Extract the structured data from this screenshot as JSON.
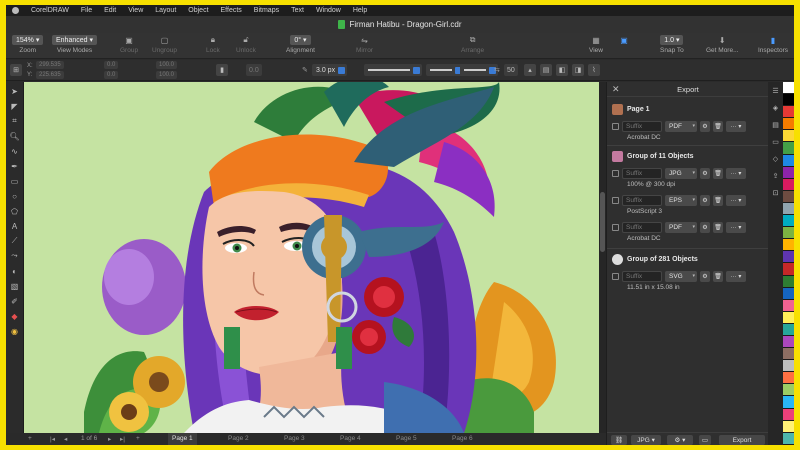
{
  "menubar": {
    "items": [
      "CorelDRAW",
      "File",
      "Edit",
      "View",
      "Layout",
      "Object",
      "Effects",
      "Bitmaps",
      "Text",
      "Window",
      "Help"
    ]
  },
  "window": {
    "title": "Firman Hatibu - Dragon-Girl.cdr"
  },
  "toolbar": {
    "zoom": {
      "value": "154%",
      "label": "Zoom"
    },
    "view_modes": {
      "value": "Enhanced",
      "label": "View Modes"
    },
    "group_label": "Group",
    "ungroup_label": "Ungroup",
    "lock_label": "Lock",
    "unlock_label": "Unlock",
    "alignment": {
      "value": "0°",
      "label": "Alignment"
    },
    "mirror_label": "Mirror",
    "arrange_label": "Arrange",
    "view_label": "View",
    "snap": {
      "value": "1.0",
      "label": "Snap To"
    },
    "get_more_label": "Get More...",
    "inspectors_label": "Inspectors"
  },
  "propbar": {
    "x": "299.535",
    "y": "225.635",
    "w": "0.0",
    "h": "0.0",
    "scale_w": "100.0",
    "scale_h": "100.0",
    "angle": "0.0",
    "outline_width": "3.0 px",
    "miter": "50"
  },
  "pages": {
    "count_label": "1 of 6",
    "tabs": [
      "Page 1",
      "Page 2",
      "Page 3",
      "Page 4",
      "Page 5",
      "Page 6"
    ],
    "active": 0
  },
  "export": {
    "title": "Export",
    "suffix_placeholder": "Suffix",
    "groups": [
      {
        "title": "Page 1",
        "rows": [
          {
            "format": "PDF",
            "info": "Acrobat DC"
          }
        ]
      },
      {
        "title": "Group of 11 Objects",
        "rows": [
          {
            "format": "JPG",
            "info": "100% @ 300 dpi"
          },
          {
            "format": "EPS",
            "info": "PostScript 3"
          },
          {
            "format": "PDF",
            "info": "Acrobat DC"
          }
        ]
      },
      {
        "title": "Group of 281 Objects",
        "rows": [
          {
            "format": "SVG",
            "info": "11.51 in x 15.08 in"
          }
        ]
      }
    ],
    "footer": {
      "format": "JPG",
      "export_label": "Export"
    }
  },
  "colors": {
    "canvas": "#c5e3a2",
    "accent": "#3a7bd5",
    "frame": "#f7e000"
  },
  "palette": [
    "#ffffff",
    "#000000",
    "#e53935",
    "#f57c00",
    "#fdd835",
    "#43a047",
    "#1e88e5",
    "#8e24aa",
    "#d81b60",
    "#6d4c41",
    "#90a4ae",
    "#00acc1",
    "#7cb342",
    "#ffb300",
    "#5e35b1",
    "#c62828",
    "#2e7d32",
    "#1565c0",
    "#f06292",
    "#ffee58",
    "#26a69a",
    "#ab47bc",
    "#8d6e63",
    "#bdbdbd",
    "#ff7043",
    "#9ccc65",
    "#29b6f6",
    "#ec407a",
    "#fff176",
    "#4db6ac"
  ]
}
